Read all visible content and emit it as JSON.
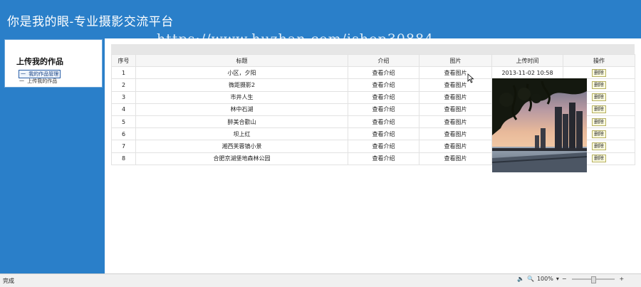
{
  "header": {
    "site_title": "你是我的眼-专业摄影交流平台",
    "watermark": "https://www.huzhan.com/ishop30884"
  },
  "sidebar": {
    "title": "上传我的作品",
    "links": [
      {
        "label": "一 我的作品管理",
        "active": true
      },
      {
        "label": "一 上传我的作品",
        "active": false
      }
    ]
  },
  "table": {
    "columns": [
      "序号",
      "标题",
      "介绍",
      "图片",
      "上传时间",
      "操作"
    ],
    "rows": [
      {
        "no": "1",
        "title": "小区，夕阳",
        "intro": "查看介绍",
        "image": "查看图片",
        "time": "2013-11-02 10:58",
        "action": "删除"
      },
      {
        "no": "2",
        "title": "微距摄影2",
        "intro": "查看介绍",
        "image": "查看图片",
        "time": "",
        "action": "删除"
      },
      {
        "no": "3",
        "title": "市井人生",
        "intro": "查看介绍",
        "image": "查看图片",
        "time": "",
        "action": "删除"
      },
      {
        "no": "4",
        "title": "林中石湖",
        "intro": "查看介绍",
        "image": "查看图片",
        "time": "",
        "action": "删除"
      },
      {
        "no": "5",
        "title": "醉美合歡山",
        "intro": "查看介绍",
        "image": "查看图片",
        "time": "",
        "action": "删除"
      },
      {
        "no": "6",
        "title": "坝上红",
        "intro": "查看介绍",
        "image": "查看图片",
        "time": "",
        "action": "删除"
      },
      {
        "no": "7",
        "title": "湘西芙蓉镇小景",
        "intro": "查看介绍",
        "image": "查看图片",
        "time": "",
        "action": "删除"
      },
      {
        "no": "8",
        "title": "合肥京湖堡地森林公园",
        "intro": "查看介绍",
        "image": "查看图片",
        "time": "",
        "action": "删除"
      }
    ]
  },
  "statusbar": {
    "status": "完成",
    "zoom": "100%"
  },
  "colors": {
    "header_bg": "#2a7fc9",
    "content_bg": "#ffffff"
  }
}
